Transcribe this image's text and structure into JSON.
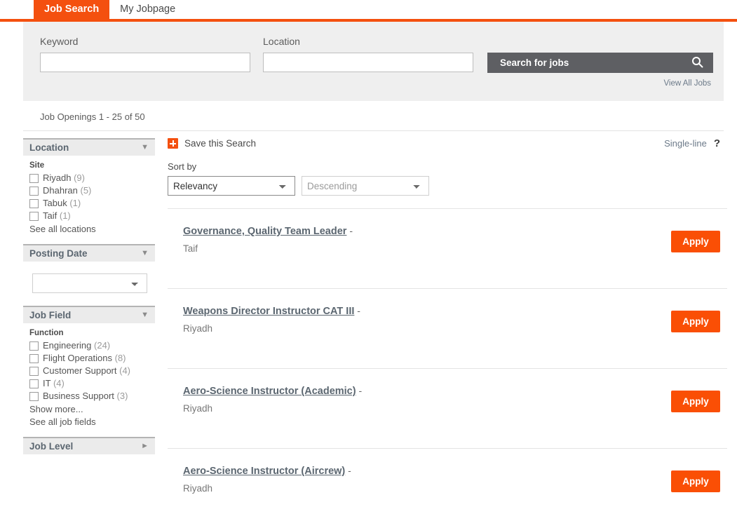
{
  "theme": {
    "accent_orange": "#f4500f",
    "apply_orange": "#fa4f05",
    "search_button_gray": "#5e5f63",
    "panel_gray": "#efefef"
  },
  "tabs": [
    {
      "label": "Job Search",
      "active": true
    },
    {
      "label": "My Jobpage",
      "active": false
    }
  ],
  "search": {
    "keyword_label": "Keyword",
    "keyword_value": "",
    "keyword_placeholder": "",
    "location_label": "Location",
    "location_value": "",
    "location_placeholder": "",
    "button_label": "Search for jobs",
    "search_icon": "search-icon",
    "view_all_label": "View All Jobs"
  },
  "results_summary": {
    "text": "Job Openings 1 - 25 of 50"
  },
  "sidebar": {
    "facets": [
      {
        "title": "Location",
        "caret": "▼",
        "expanded": true,
        "group_label": "Site",
        "items": [
          {
            "label": "Riyadh",
            "count": "(9)",
            "checked": false
          },
          {
            "label": "Dhahran",
            "count": "(5)",
            "checked": false
          },
          {
            "label": "Tabuk",
            "count": "(1)",
            "checked": false
          },
          {
            "label": "Taif",
            "count": "(1)",
            "checked": false
          }
        ],
        "links": [
          "See all locations"
        ]
      },
      {
        "title": "Posting Date",
        "caret": "▼",
        "expanded": true,
        "select_value": "",
        "select_options": [
          ""
        ]
      },
      {
        "title": "Job Field",
        "caret": "▼",
        "expanded": true,
        "group_label": "Function",
        "items": [
          {
            "label": "Engineering",
            "count": "(24)",
            "checked": false
          },
          {
            "label": "Flight Operations",
            "count": "(8)",
            "checked": false
          },
          {
            "label": "Customer Support",
            "count": "(4)",
            "checked": false
          },
          {
            "label": "IT",
            "count": "(4)",
            "checked": false
          },
          {
            "label": "Business Support",
            "count": "(3)",
            "checked": false
          }
        ],
        "links": [
          "Show more...",
          "See all job fields"
        ]
      },
      {
        "title": "Job Level",
        "caret": "►",
        "expanded": false
      }
    ]
  },
  "main": {
    "save_search_label": "Save this Search",
    "save_search_icon": "plus-icon",
    "view_mode_label": "Single-line",
    "help_icon": "?",
    "sort": {
      "label": "Sort by",
      "criterion_value": "Relevancy",
      "criterion_options": [
        "Relevancy"
      ],
      "direction_value": "Descending",
      "direction_options": [
        "Descending"
      ]
    },
    "apply_label": "Apply",
    "jobs": [
      {
        "title": "Governance, Quality Team Leader",
        "dash": "-",
        "location": "Taif"
      },
      {
        "title": "Weapons Director Instructor CAT III",
        "dash": "-",
        "location": "Riyadh"
      },
      {
        "title": "Aero-Science Instructor (Academic)",
        "dash": "-",
        "location": "Riyadh"
      },
      {
        "title": "Aero-Science Instructor (Aircrew)",
        "dash": "-",
        "location": "Riyadh"
      }
    ]
  }
}
